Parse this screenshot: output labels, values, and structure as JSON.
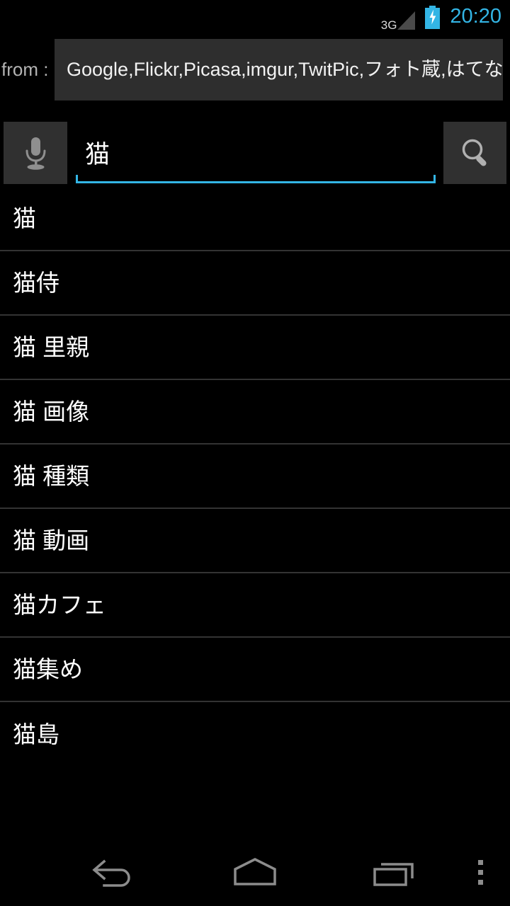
{
  "status_bar": {
    "network_label": "3G",
    "network_icon": "signal-triangle-icon",
    "battery_icon": "battery-charging-icon",
    "clock": "20:20",
    "accent_color": "#33b5e5"
  },
  "source_row": {
    "label": "from :",
    "value": "Google,Flickr,Picasa,imgur,TwitPic,フォト蔵,はてなフォ",
    "box_color": "#2e2e2e"
  },
  "search_row": {
    "mic_icon": "microphone-icon",
    "search_icon": "magnifier-icon",
    "query": "猫",
    "placeholder": "",
    "underline_color": "#33b5e5",
    "button_color": "#303030"
  },
  "suggestions": [
    {
      "label": "猫"
    },
    {
      "label": "猫侍"
    },
    {
      "label": "猫 里親"
    },
    {
      "label": "猫 画像"
    },
    {
      "label": "猫 種類"
    },
    {
      "label": "猫 動画"
    },
    {
      "label": "猫カフェ"
    },
    {
      "label": "猫集め"
    },
    {
      "label": "猫島"
    }
  ],
  "nav_bar": {
    "back_icon": "back-arrow-icon",
    "home_icon": "home-icon",
    "recents_icon": "recents-icon",
    "menu_icon": "overflow-menu-icon",
    "icon_color": "#8c8c8c"
  }
}
